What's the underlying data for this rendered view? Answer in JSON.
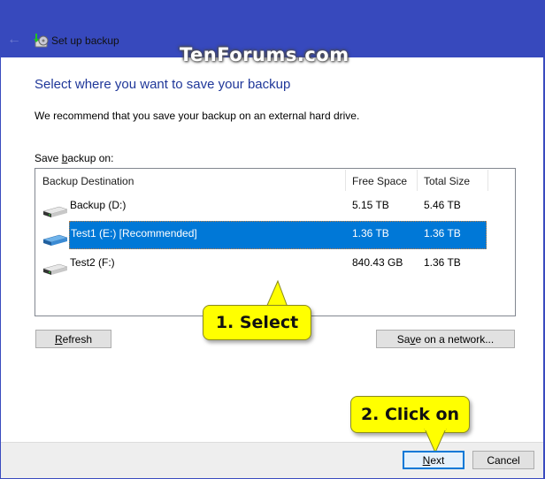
{
  "window": {
    "title": "Set up backup",
    "watermark": "TenForums.com",
    "accent_color": "#3749bd"
  },
  "page": {
    "heading": "Select where you want to save your backup",
    "recommendation": "We recommend that you save your backup on an external hard drive.",
    "save_label_prefix": "Save ",
    "save_label_accel": "b",
    "save_label_suffix": "ackup on:"
  },
  "table": {
    "columns": [
      "Backup Destination",
      "Free Space",
      "Total Size"
    ],
    "rows": [
      {
        "icon": "hard-drive-icon",
        "destination": "Backup (D:)",
        "free_space": "5.15 TB",
        "total_size": "5.46 TB",
        "selected": false
      },
      {
        "icon": "hard-drive-external-icon",
        "destination": "Test1 (E:) [Recommended]",
        "free_space": "1.36 TB",
        "total_size": "1.36 TB",
        "selected": true
      },
      {
        "icon": "hard-drive-icon",
        "destination": "Test2 (F:)",
        "free_space": "840.43 GB",
        "total_size": "1.36 TB",
        "selected": false
      }
    ],
    "selection_color": "#0078d7"
  },
  "buttons": {
    "refresh_accel": "R",
    "refresh_rest": "efresh",
    "network_pre": "Sa",
    "network_accel": "v",
    "network_rest": "e on a network...",
    "next_accel": "N",
    "next_rest": "ext",
    "cancel": "Cancel"
  },
  "callouts": {
    "step1": "1. Select",
    "step2": "2. Click on"
  }
}
